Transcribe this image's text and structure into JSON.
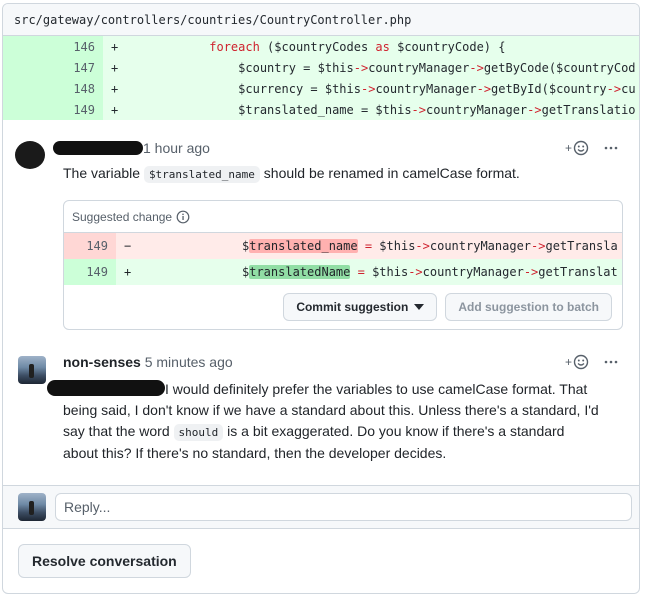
{
  "file": {
    "path": "src/gateway/controllers/countries/CountryController.php"
  },
  "diff_lines": [
    {
      "num": "146",
      "sign": "+",
      "indent": "          ",
      "parts": [
        [
          "kw",
          "foreach"
        ],
        [
          "var",
          " ($countryCodes "
        ],
        [
          "kw",
          "as"
        ],
        [
          "var",
          " $countryCode) {"
        ]
      ]
    },
    {
      "num": "147",
      "sign": "+",
      "indent": "              ",
      "parts": [
        [
          "var",
          "$country = $this"
        ],
        [
          "op",
          "->"
        ],
        [
          "var",
          "countryManager"
        ],
        [
          "op",
          "->"
        ],
        [
          "var",
          "getByCode($countryCod"
        ]
      ]
    },
    {
      "num": "148",
      "sign": "+",
      "indent": "              ",
      "parts": [
        [
          "var",
          "$currency = $this"
        ],
        [
          "op",
          "->"
        ],
        [
          "var",
          "countryManager"
        ],
        [
          "op",
          "->"
        ],
        [
          "var",
          "getById($country"
        ],
        [
          "op",
          "->"
        ],
        [
          "var",
          "cu"
        ]
      ]
    },
    {
      "num": "149",
      "sign": "+",
      "indent": "              ",
      "parts": [
        [
          "var",
          "$translated_name = $this"
        ],
        [
          "op",
          "->"
        ],
        [
          "var",
          "countryManager"
        ],
        [
          "op",
          "->"
        ],
        [
          "var",
          "getTranslatio"
        ]
      ]
    }
  ],
  "comment1": {
    "time": "1 hour ago",
    "text_before": "The variable ",
    "code": "$translated_name",
    "text_after": " should be renamed in camelCase format.",
    "suggestion": {
      "header": "Suggested change",
      "del_num": "149",
      "del_sign": "−",
      "del_prefix": "$",
      "del_hl": "translated_name",
      "del_rest_parts": [
        [
          "op",
          " = "
        ],
        [
          "var",
          "$this"
        ],
        [
          "op",
          "->"
        ],
        [
          "var",
          "countryManager"
        ],
        [
          "op",
          "->"
        ],
        [
          "var",
          "getTransla"
        ]
      ],
      "add_num": "149",
      "add_sign": "+",
      "add_prefix": "$",
      "add_hl": "translatedName",
      "add_rest_parts": [
        [
          "op",
          " = "
        ],
        [
          "var",
          "$this"
        ],
        [
          "op",
          "->"
        ],
        [
          "var",
          "countryManager"
        ],
        [
          "op",
          "->"
        ],
        [
          "var",
          "getTranslat"
        ]
      ],
      "commit_label": "Commit suggestion",
      "batch_label": "Add suggestion to batch"
    }
  },
  "comment2": {
    "author": "non-senses",
    "time": "5 minutes ago",
    "line1": "I would definitely prefer the variables to use camelCase format. That",
    "line2": "being said, I don't know if we have a standard about this. Unless there's a standard, I'd",
    "line3_before": "say that the word ",
    "line3_code": "should",
    "line3_after": " is a bit exaggerated. Do you know if there's a standard",
    "line4": "about this? If there's no standard, then the developer decides."
  },
  "reply": {
    "placeholder": "Reply..."
  },
  "resolve_label": "Resolve conversation",
  "colors": {
    "add_bg": "#e6ffec",
    "del_bg": "#ffebe9",
    "border": "#d0d7de"
  },
  "icons": [
    "info-icon",
    "smiley-add-icon",
    "kebab-icon",
    "triangle-down-icon"
  ]
}
